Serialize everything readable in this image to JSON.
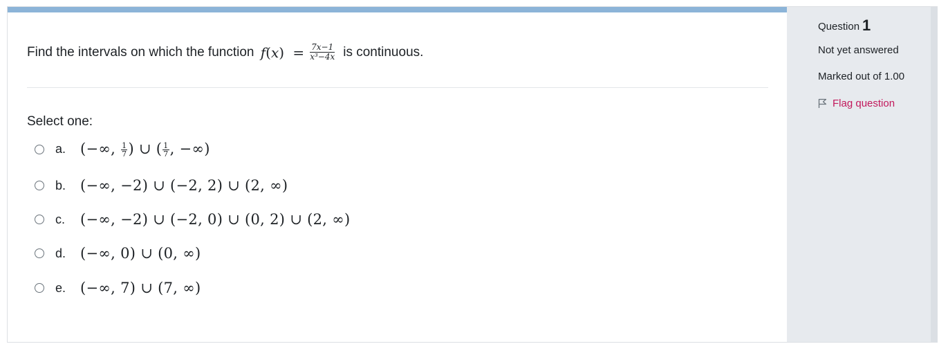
{
  "question": {
    "text_before": "Find the intervals on which the function ",
    "function_name": "f",
    "function_arg": "x",
    "equals": "=",
    "numerator": "7x−1",
    "denominator": "x³−4x",
    "text_after": "is continuous.",
    "prompt": "Select one:"
  },
  "options": [
    {
      "letter": "a.",
      "parts": [
        "(−∞, ",
        "1",
        "7",
        ") ∪ (",
        "1",
        "7",
        ", −∞)"
      ]
    },
    {
      "letter": "b.",
      "text": "(−∞, −2) ∪ (−2, 2) ∪ (2, ∞)"
    },
    {
      "letter": "c.",
      "text": "(−∞, −2) ∪ (−2, 0) ∪ (0, 2) ∪ (2, ∞)"
    },
    {
      "letter": "d.",
      "text": "(−∞, 0) ∪ (0, ∞)"
    },
    {
      "letter": "e.",
      "text": "(−∞, 7) ∪ (7, ∞)"
    }
  ],
  "info": {
    "question_label": "Question",
    "question_number": "1",
    "state": "Not yet answered",
    "grade": "Marked out of 1.00",
    "flag_label": "Flag question",
    "flag_icon": "flag-outline-icon"
  },
  "colors": {
    "top_bar": "#8cb4d8",
    "sidebar_bg": "#e7eaee",
    "flag_link": "#c2185b"
  }
}
